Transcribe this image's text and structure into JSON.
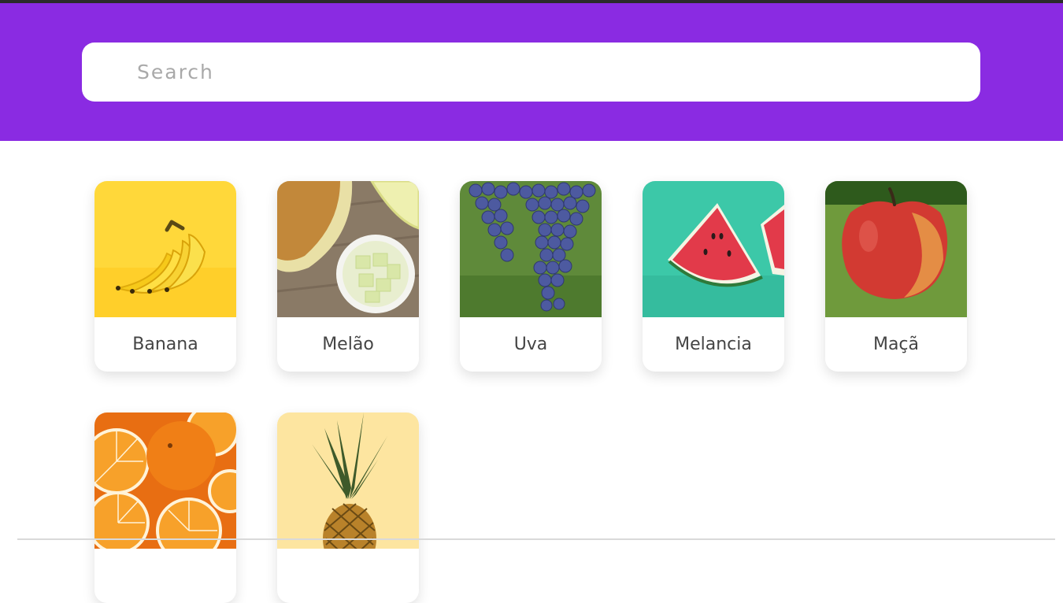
{
  "search": {
    "placeholder": "Search",
    "value": ""
  },
  "colors": {
    "header": "#8a2be2",
    "card_bg": "#ffffff",
    "label": "#444444"
  },
  "fruits": [
    {
      "name": "Banana",
      "image": "banana-photo"
    },
    {
      "name": "Melão",
      "image": "melon-photo"
    },
    {
      "name": "Uva",
      "image": "grape-photo"
    },
    {
      "name": "Melancia",
      "image": "watermelon-photo"
    },
    {
      "name": "Maçã",
      "image": "apple-photo"
    },
    {
      "name": "",
      "image": "orange-photo"
    },
    {
      "name": "",
      "image": "pineapple-photo"
    }
  ]
}
